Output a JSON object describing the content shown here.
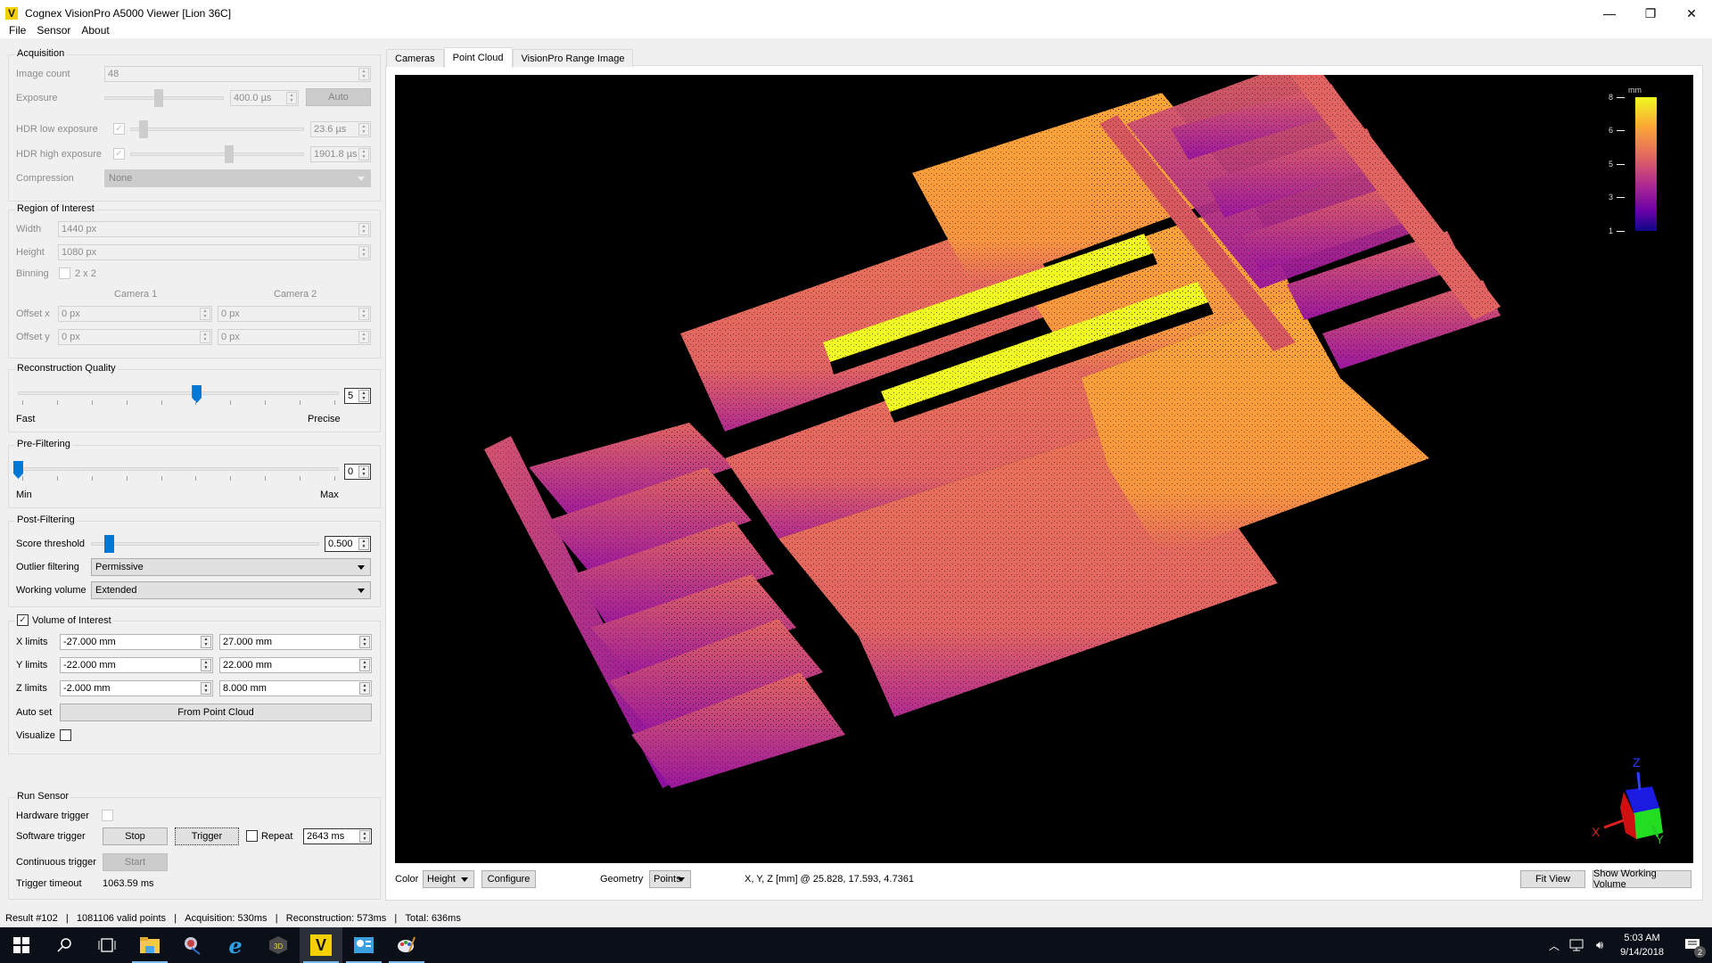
{
  "window": {
    "title": "Cognex VisionPro A5000 Viewer [Lion 36C]",
    "logo_glyph": "V",
    "minimize": "—",
    "maximize": "❐",
    "close": "✕"
  },
  "menu": [
    "File",
    "Sensor",
    "About"
  ],
  "acquisition": {
    "title": "Acquisition",
    "image_count": {
      "label": "Image count",
      "value": "48"
    },
    "exposure": {
      "label": "Exposure",
      "value": "400.0 µs",
      "auto_label": "Auto",
      "slider_fraction": 0.45
    },
    "hdr_low": {
      "label": "HDR low exposure",
      "checked": true,
      "value": "23.6 µs",
      "slider_fraction": 0.1
    },
    "hdr_high": {
      "label": "HDR high exposure",
      "checked": true,
      "value": "1901.8 µs",
      "slider_fraction": 0.6
    },
    "compression": {
      "label": "Compression",
      "value": "None"
    }
  },
  "roi": {
    "title": "Region of Interest",
    "width": {
      "label": "Width",
      "value": "1440 px"
    },
    "height": {
      "label": "Height",
      "value": "1080 px"
    },
    "binning": {
      "label": "Binning",
      "option": "2 x 2",
      "checked": false
    },
    "camera1": "Camera 1",
    "camera2": "Camera 2",
    "offset_x": {
      "label": "Offset x",
      "cam1": "0 px",
      "cam2": "0 px"
    },
    "offset_y": {
      "label": "Offset y",
      "cam1": "0 px",
      "cam2": "0 px"
    }
  },
  "reconstruction": {
    "title": "Reconstruction Quality",
    "value": "5",
    "min_label": "Fast",
    "max_label": "Precise",
    "slider_fraction": 0.556
  },
  "prefilter": {
    "title": "Pre-Filtering",
    "value": "0",
    "min_label": "Min",
    "max_label": "Max",
    "slider_fraction": 0.0
  },
  "postfilter": {
    "title": "Post-Filtering",
    "score": {
      "label": "Score threshold",
      "value": "0.500",
      "slider_fraction": 0.05
    },
    "outlier": {
      "label": "Outlier filtering",
      "value": "Permissive"
    },
    "working_volume": {
      "label": "Working volume",
      "value": "Extended"
    }
  },
  "voi": {
    "title": "Volume of Interest",
    "enabled": true,
    "x": {
      "label": "X limits",
      "min": "-27.000 mm",
      "max": "27.000 mm"
    },
    "y": {
      "label": "Y limits",
      "min": "-22.000 mm",
      "max": "22.000 mm"
    },
    "z": {
      "label": "Z limits",
      "min": "-2.000 mm",
      "max": "8.000 mm"
    },
    "autoset": {
      "label": "Auto set",
      "button": "From Point Cloud"
    },
    "visualize": {
      "label": "Visualize",
      "checked": false
    }
  },
  "run": {
    "title": "Run Sensor",
    "hardware": {
      "label": "Hardware trigger",
      "checked": false
    },
    "software": {
      "label": "Software trigger",
      "stop": "Stop",
      "trigger": "Trigger",
      "repeat_label": "Repeat",
      "repeat_checked": false,
      "interval": "2643 ms"
    },
    "continuous": {
      "label": "Continuous trigger",
      "start": "Start"
    },
    "timeout": {
      "label": "Trigger timeout",
      "value": "1063.59 ms"
    }
  },
  "tabs": [
    {
      "label": "Cameras",
      "active": false
    },
    {
      "label": "Point Cloud",
      "active": true
    },
    {
      "label": "VisionPro Range Image",
      "active": false
    }
  ],
  "viewer": {
    "legend": {
      "unit": "mm",
      "ticks": [
        "8",
        "6",
        "5",
        "3",
        "1"
      ]
    },
    "axes": {
      "x": "X",
      "y": "Y",
      "z": "Z"
    },
    "colors": {
      "background": "#000000",
      "high": "#f0f921",
      "mid_high": "#fca636",
      "mid": "#e16462",
      "mid_low": "#b12a90",
      "low": "#6a00a8",
      "lowest": "#0d0887"
    }
  },
  "viewer_bar": {
    "color_label": "Color",
    "color_value": "Height",
    "configure": "Configure",
    "geometry_label": "Geometry",
    "geometry_value": "Points",
    "coords": "X, Y, Z [mm] @ 25.828, 17.593, 4.7361",
    "fit_view": "Fit View",
    "show_volume": "Show Working Volume"
  },
  "status": {
    "result": "Result #102",
    "points": "1081106 valid points",
    "acquisition": "Acquisition: 530ms",
    "reconstruction": "Reconstruction: 573ms",
    "total": "Total: 636ms",
    "sep": "   |   "
  },
  "taskbar": {
    "time": "5:03 AM",
    "date": "9/14/2018",
    "notifications": "2"
  }
}
